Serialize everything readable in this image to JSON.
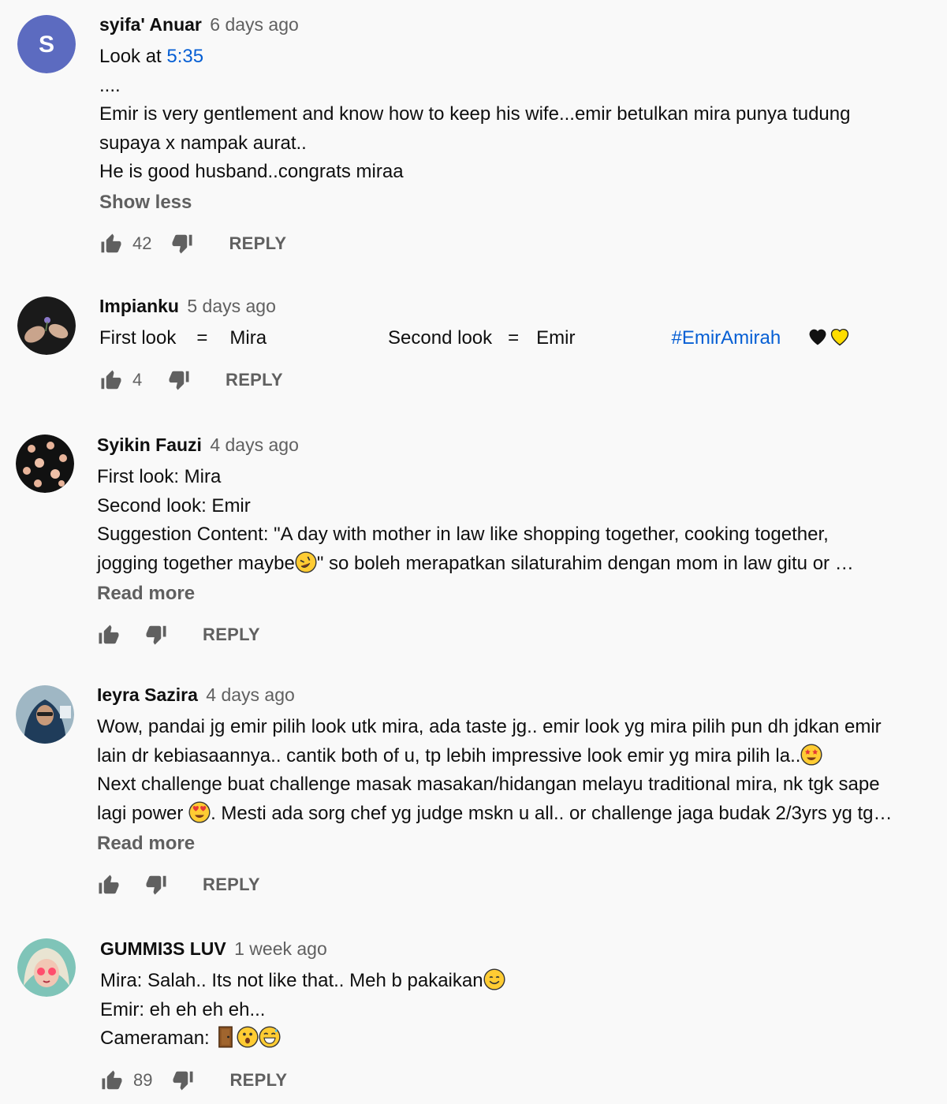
{
  "comments": [
    {
      "author": "syifa' Anuar",
      "time": "6 days ago",
      "avatar_letter": "S",
      "avatar_color": "#5c6bc0",
      "line1_prefix": "Look at ",
      "line1_link": "5:35",
      "line2": "....",
      "line3": "Emir is very gentlement and know how to keep his wife...emir betulkan mira punya tudung",
      "line4": "supaya x nampak aurat..",
      "line5": "He is good husband..congrats miraa",
      "more_label": "Show less",
      "likes": "42",
      "reply_label": "REPLY"
    },
    {
      "author": "Impianku",
      "time": "5 days ago",
      "seg1": "First look",
      "seg2": "=",
      "seg3": "Mira",
      "seg4": "Second look",
      "seg5": "=",
      "seg6": "Emir",
      "hashtag": "#EmirAmirah",
      "likes": "4",
      "reply_label": "REPLY"
    },
    {
      "author": "Syikin Fauzi",
      "time": "4 days ago",
      "line1": "First look: Mira",
      "line2": "Second look: Emir",
      "line3": "Suggestion Content: \"A day with mother in law like shopping together, cooking together,",
      "line4a": "jogging together maybe",
      "line4b": "\" so boleh merapatkan silaturahim dengan mom in law gitu or …",
      "more_label": "Read more",
      "reply_label": "REPLY"
    },
    {
      "author": "Ieyra Sazira",
      "time": "4 days ago",
      "line1": "Wow, pandai jg emir pilih look utk mira, ada taste jg.. emir look yg mira pilih pun dh jdkan emir",
      "line2": "lain dr kebiasaannya.. cantik both of u, tp lebih impressive look emir yg mira pilih la..",
      "line3": "Next challenge buat challenge masak masakan/hidangan melayu traditional mira,  nk tgk sape",
      "line4a": "lagi power ",
      "line4b": ". Mesti ada sorg chef yg judge mskn u all.. or challenge jaga budak 2/3yrs yg tg…",
      "more_label": "Read more",
      "reply_label": "REPLY"
    },
    {
      "author": "GUMMI3S LUV",
      "time": "1 week ago",
      "line1": "Mira: Salah.. Its not like that.. Meh b pakaikan",
      "line2": "Emir: eh eh eh eh...",
      "line3": "Cameraman: ",
      "likes": "89",
      "reply_label": "REPLY"
    }
  ],
  "colors": {
    "link": "#065fd4",
    "secondary_text": "#606060",
    "background": "#f9f9f9"
  },
  "icons": [
    "thumb-up-icon",
    "thumb-down-icon",
    "heart-icon",
    "emoji-icon",
    "door-icon"
  ]
}
